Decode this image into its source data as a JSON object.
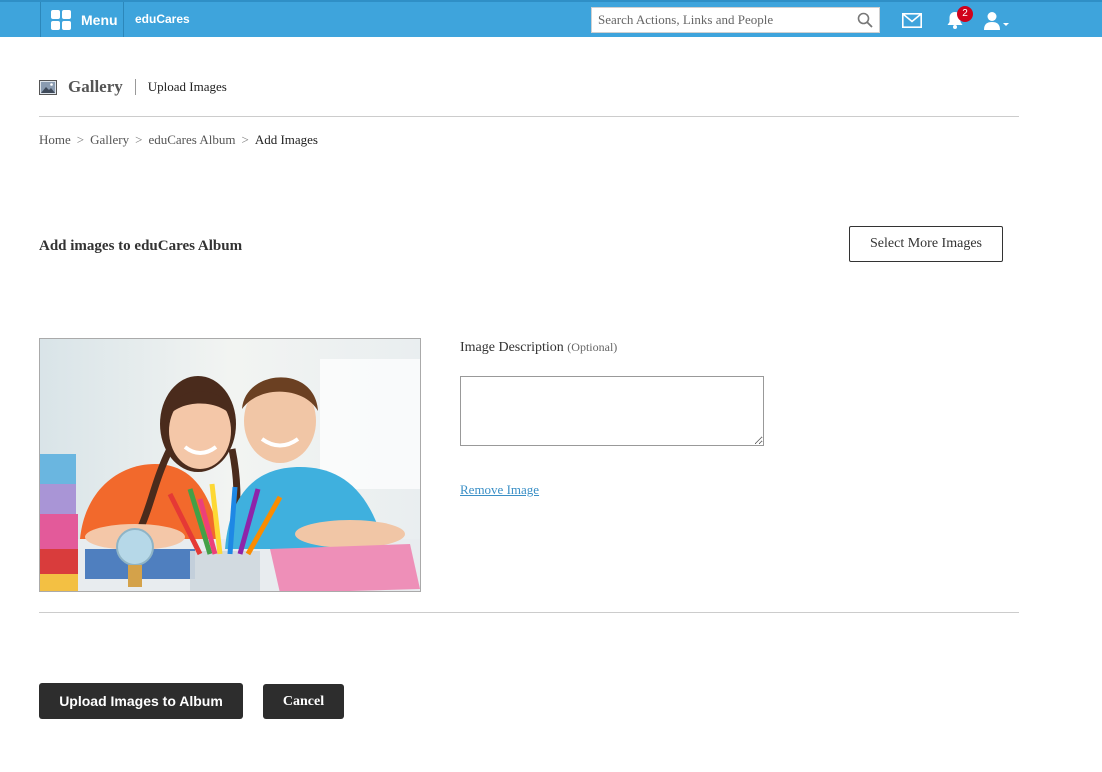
{
  "topbar": {
    "menu_label": "Menu",
    "brand": "eduCares",
    "search_placeholder": "Search Actions, Links and People",
    "notification_count": "2",
    "bar_color": "#3ea4dc"
  },
  "header": {
    "title": "Gallery",
    "subtitle": "Upload Images"
  },
  "breadcrumb": {
    "items": [
      "Home",
      "Gallery",
      "eduCares Album",
      "Add Images"
    ],
    "separator": ">"
  },
  "main": {
    "section_title": "Add images to eduCares Album",
    "select_more_label": "Select More Images",
    "description_label": "Image Description",
    "description_optional": "(Optional)",
    "description_value": "",
    "remove_label": "Remove Image"
  },
  "footer": {
    "upload_label": "Upload Images to Album",
    "cancel_label": "Cancel"
  },
  "icons": {
    "menu": "grid-icon",
    "search": "search-icon",
    "mail": "mail-icon",
    "notifications": "bell-icon",
    "user": "user-icon",
    "gallery": "gallery-icon"
  }
}
